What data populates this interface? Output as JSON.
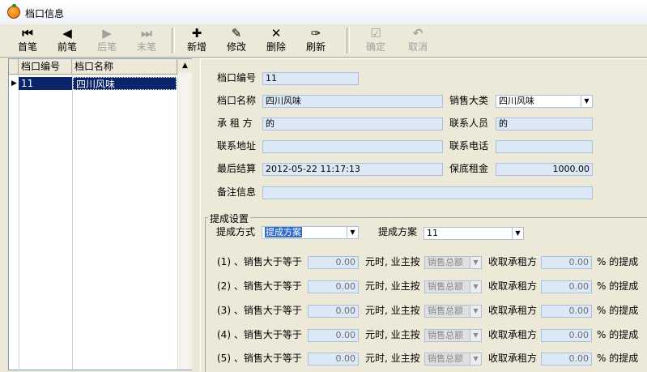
{
  "window": {
    "title": "档口信息"
  },
  "toolbar": {
    "buttons": [
      {
        "label": "首笔",
        "icon": "first-record-icon",
        "glyph": "⏮",
        "enabled": true
      },
      {
        "label": "前笔",
        "icon": "prev-record-icon",
        "glyph": "◀",
        "enabled": true
      },
      {
        "label": "后笔",
        "icon": "next-record-icon",
        "glyph": "▶",
        "enabled": false
      },
      {
        "label": "末笔",
        "icon": "last-record-icon",
        "glyph": "⏭",
        "enabled": false
      },
      {
        "label": "新增",
        "icon": "new-record-icon",
        "glyph": "✚",
        "enabled": true
      },
      {
        "label": "修改",
        "icon": "edit-icon",
        "glyph": "✎",
        "enabled": true
      },
      {
        "label": "删除",
        "icon": "delete-icon",
        "glyph": "✕",
        "enabled": true
      },
      {
        "label": "刷新",
        "icon": "refresh-icon",
        "glyph": "✑",
        "enabled": true
      },
      {
        "label": "确定",
        "icon": "confirm-icon",
        "glyph": "☑",
        "enabled": false
      },
      {
        "label": "取消",
        "icon": "undo-icon",
        "glyph": "↶",
        "enabled": false
      }
    ]
  },
  "grid": {
    "columns": [
      "档口编号",
      "档口名称"
    ],
    "rows": [
      [
        "11",
        "四川风味"
      ]
    ],
    "row_indicator": "▶"
  },
  "form": {
    "code_label": "档口编号",
    "code_value": "11",
    "name_label": "档口名称",
    "name_value": "四川风味",
    "category_label": "销售大类",
    "category_value": "四川风味",
    "tenant_label": "承 租 方",
    "tenant_value": "的",
    "contact_label": "联系人员",
    "contact_value": "的",
    "address_label": "联系地址",
    "address_value": "",
    "phone_label": "联系电话",
    "phone_value": "",
    "last_settle_label": "最后结算",
    "last_settle_value": "2012-05-22 11:17:13",
    "min_rent_label": "保底租金",
    "min_rent_value": "1000.00",
    "remark_label": "备注信息",
    "remark_value": ""
  },
  "commission": {
    "group_title": "提成设置",
    "mode_label": "提成方式",
    "mode_value": "提成方案",
    "plan_label": "提成方案",
    "plan_value": "11",
    "tiers": [
      {
        "prefix": "(1) 、销售大于等于",
        "amount": "0.00",
        "mid": "元时, 业主按",
        "basis": "销售总额",
        "collect": "收取承租方",
        "pct": "0.00",
        "suffix": "% 的提成"
      },
      {
        "prefix": "(2) 、销售大于等于",
        "amount": "0.00",
        "mid": "元时, 业主按",
        "basis": "销售总额",
        "collect": "收取承租方",
        "pct": "0.00",
        "suffix": "% 的提成"
      },
      {
        "prefix": "(3) 、销售大于等于",
        "amount": "0.00",
        "mid": "元时, 业主按",
        "basis": "销售总额",
        "collect": "收取承租方",
        "pct": "0.00",
        "suffix": "% 的提成"
      },
      {
        "prefix": "(4) 、销售大于等于",
        "amount": "0.00",
        "mid": "元时, 业主按",
        "basis": "销售总额",
        "collect": "收取承租方",
        "pct": "0.00",
        "suffix": "% 的提成"
      },
      {
        "prefix": "(5) 、销售大于等于",
        "amount": "0.00",
        "mid": "元时, 业主按",
        "basis": "销售总额",
        "collect": "收取承租方",
        "pct": "0.00",
        "suffix": "% 的提成"
      }
    ]
  },
  "colors": {
    "selection": "#0a246a",
    "field_bg": "#dce8f5",
    "chrome": "#ece9d8"
  }
}
